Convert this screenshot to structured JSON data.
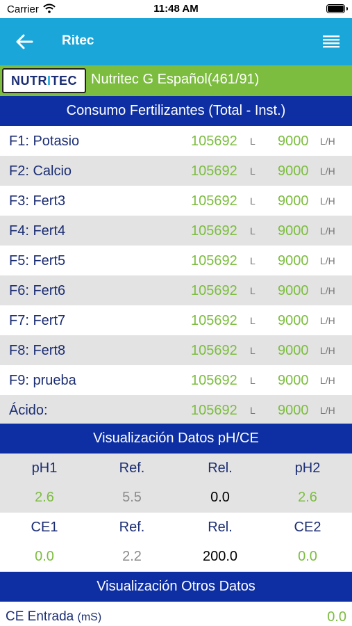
{
  "status_bar": {
    "carrier": "Carrier",
    "time": "11:48 AM"
  },
  "nav": {
    "title": "Ritec"
  },
  "device": {
    "logo_text": "NUTRITEC",
    "name": "Nutritec G Español(461/91)"
  },
  "consumo": {
    "header": "Consumo Fertilizantes (Total -  Inst.)",
    "rows": [
      {
        "name": "F1: Potasio",
        "total": "105692",
        "total_unit": "L",
        "inst": "9000",
        "inst_unit": "L/H"
      },
      {
        "name": "F2: Calcio",
        "total": "105692",
        "total_unit": "L",
        "inst": "9000",
        "inst_unit": "L/H"
      },
      {
        "name": "F3: Fert3",
        "total": "105692",
        "total_unit": "L",
        "inst": "9000",
        "inst_unit": "L/H"
      },
      {
        "name": "F4: Fert4",
        "total": "105692",
        "total_unit": "L",
        "inst": "9000",
        "inst_unit": "L/H"
      },
      {
        "name": "F5: Fert5",
        "total": "105692",
        "total_unit": "L",
        "inst": "9000",
        "inst_unit": "L/H"
      },
      {
        "name": "F6: Fert6",
        "total": "105692",
        "total_unit": "L",
        "inst": "9000",
        "inst_unit": "L/H"
      },
      {
        "name": "F7: Fert7",
        "total": "105692",
        "total_unit": "L",
        "inst": "9000",
        "inst_unit": "L/H"
      },
      {
        "name": "F8: Fert8",
        "total": "105692",
        "total_unit": "L",
        "inst": "9000",
        "inst_unit": "L/H"
      },
      {
        "name": "F9: prueba",
        "total": "105692",
        "total_unit": "L",
        "inst": "9000",
        "inst_unit": "L/H"
      },
      {
        "name": "Ácido:",
        "total": "105692",
        "total_unit": "L",
        "inst": "9000",
        "inst_unit": "L/H"
      }
    ]
  },
  "ph_ce": {
    "header": "Visualización Datos pH/CE",
    "ph_labels": [
      "pH1",
      "Ref.",
      "Rel.",
      "pH2"
    ],
    "ph_values": [
      "2.6",
      "5.5",
      "0.0",
      "2.6"
    ],
    "ce_labels": [
      "CE1",
      "Ref.",
      "Rel.",
      "CE2"
    ],
    "ce_values": [
      "0.0",
      "2.2",
      "200.0",
      "0.0"
    ]
  },
  "otros": {
    "header": "Visualización Otros Datos",
    "rows": [
      {
        "label": "CE Entrada",
        "unit": "(mS)",
        "value": "0.0"
      }
    ]
  }
}
